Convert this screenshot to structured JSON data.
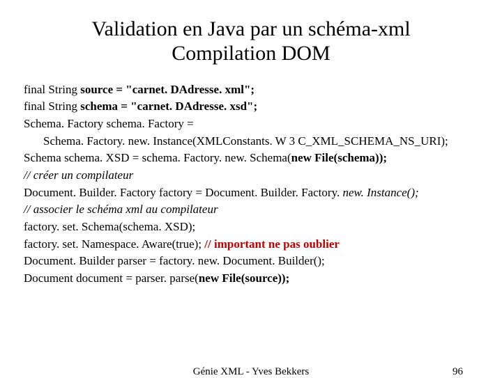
{
  "title_line1": "Validation en Java par un schéma-xml",
  "title_line2": "Compilation DOM",
  "code": {
    "l1a": "final String ",
    "l1b": "source = \"carnet. DAdresse. xml\";",
    "l2a": "final String ",
    "l2b": "schema = \"carnet. DAdresse. xsd\";",
    "l3": "Schema. Factory schema. Factory =",
    "l4": "Schema. Factory. new. Instance(XMLConstants. W 3 C_XML_SCHEMA_NS_URI);",
    "l5a": "Schema schema. XSD = schema. Factory. new. Schema(",
    "l5b": "new File(schema));",
    "l6": "// créer un compilateur",
    "l7a": "Document. Builder. Factory factory = Document. Builder. Factory. ",
    "l7b": "new. Instance();",
    "l8": "// associer le schéma xml au compilateur",
    "l9": "factory. set. Schema(schema. XSD);",
    "l10a": "factory. set. Namespace. Aware(true);  ",
    "l10b": "// important ne pas oublier",
    "l11": "Document. Builder parser = factory. new. Document. Builder();",
    "l12a": "Document document = parser. parse(",
    "l12b": "new File(source));"
  },
  "footer": {
    "center": "Génie XML - Yves Bekkers",
    "page": "96"
  }
}
